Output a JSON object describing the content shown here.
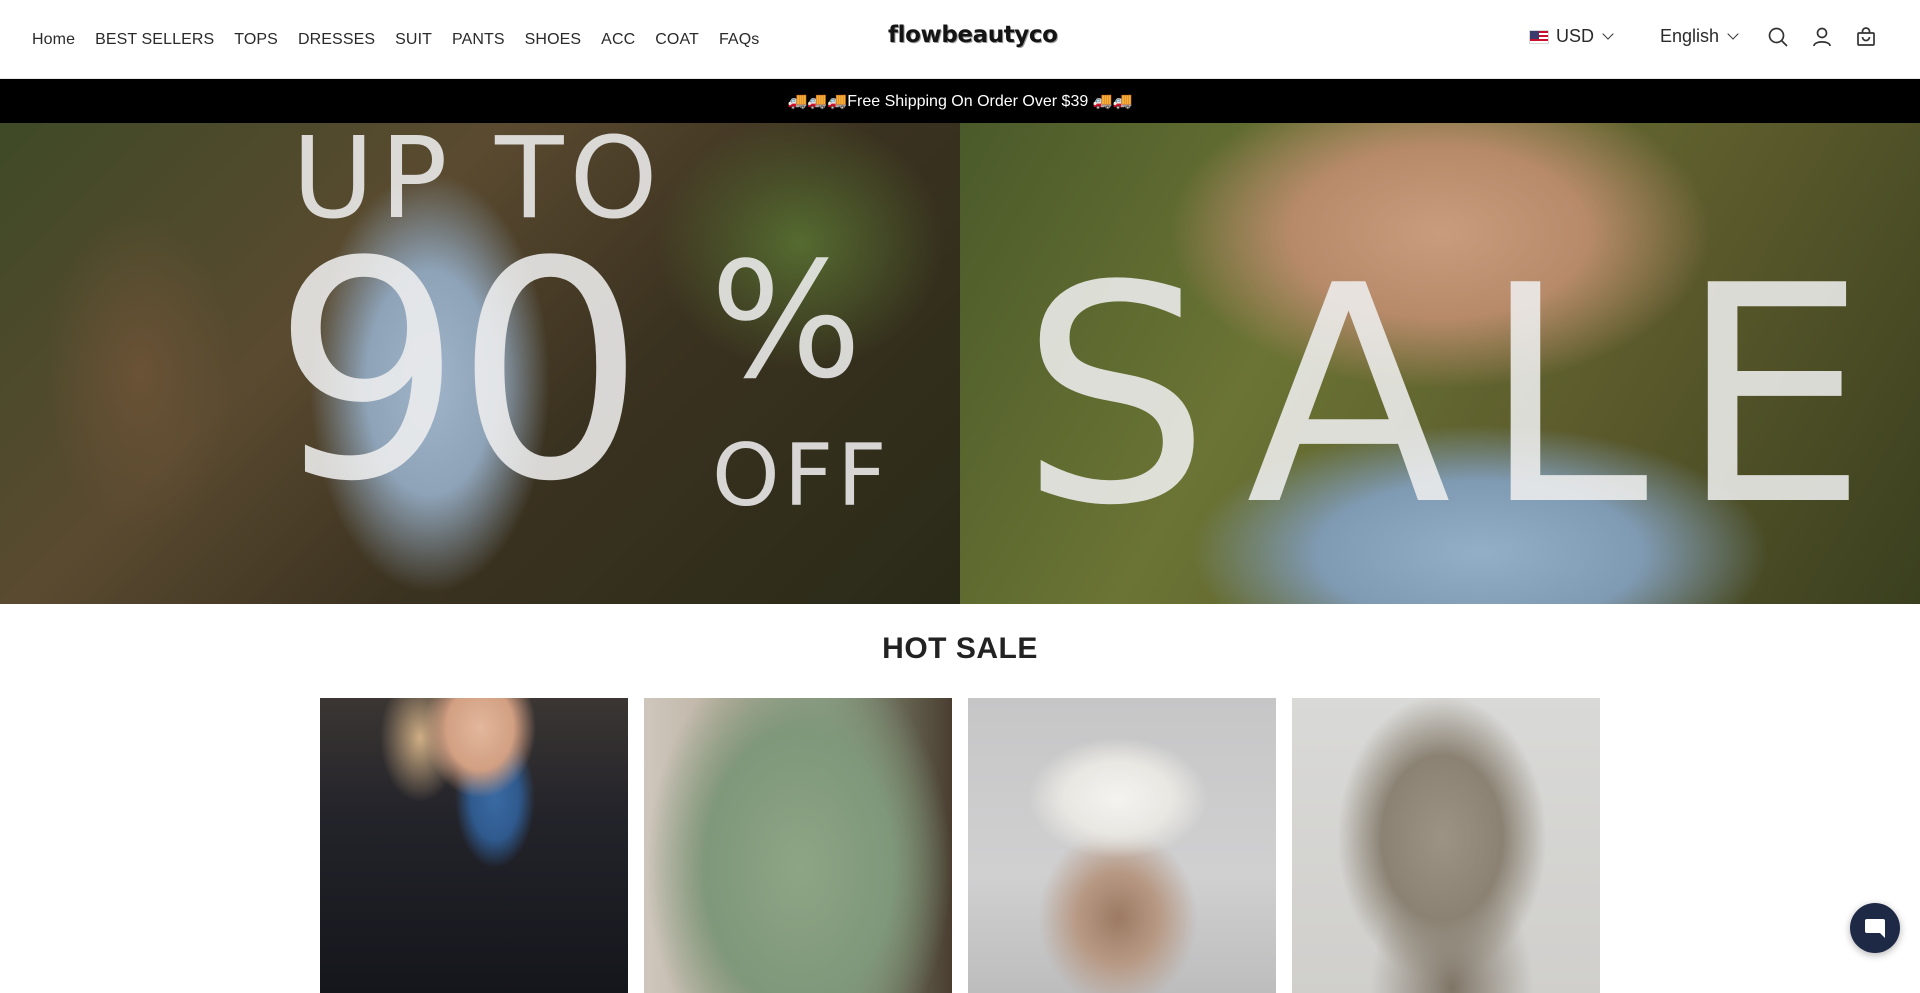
{
  "header": {
    "nav_items": [
      {
        "label": "Home"
      },
      {
        "label": "BEST SELLERS"
      },
      {
        "label": "TOPS"
      },
      {
        "label": "DRESSES"
      },
      {
        "label": "SUIT"
      },
      {
        "label": "PANTS"
      },
      {
        "label": "SHOES"
      },
      {
        "label": "ACC"
      },
      {
        "label": "COAT"
      },
      {
        "label": "FAQs"
      }
    ],
    "logo": "flowbeautyco",
    "currency": {
      "label": "USD",
      "flag_icon": "us-flag-icon"
    },
    "language": {
      "label": "English"
    },
    "icons": [
      "search-icon",
      "account-icon",
      "cart-icon"
    ]
  },
  "announcement": {
    "text": "🚚🚚🚚Free Shipping On Order Over $39 🚚🚚"
  },
  "hero": {
    "line_upto": "UP TO",
    "percent_number": "90",
    "percent_sign": "%",
    "off_text": "OFF",
    "sale_text": "SALE"
  },
  "hot_sale": {
    "title": "HOT SALE",
    "products": [
      {
        "image": "navy-sweater-denim-collar"
      },
      {
        "image": "sage-green-linen-top"
      },
      {
        "image": "white-brown-gradient-set"
      },
      {
        "image": "taupe-satin-jumpsuit"
      }
    ]
  },
  "chat": {
    "icon": "chat-icon"
  },
  "colors": {
    "announcement_bg": "#000000",
    "announcement_text": "#ffffff",
    "chat_bg": "#1e2a45"
  }
}
